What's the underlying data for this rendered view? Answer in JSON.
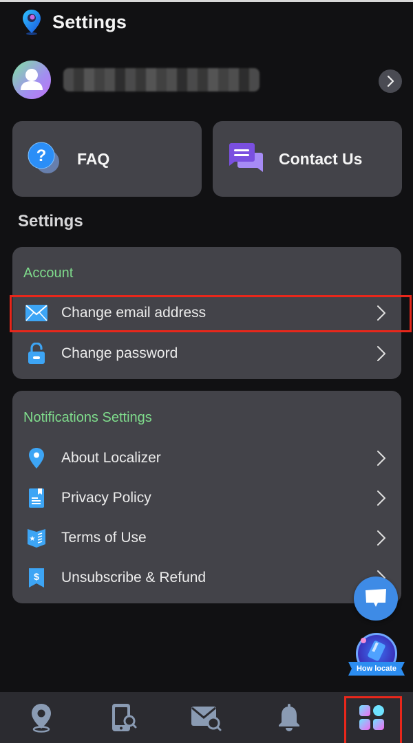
{
  "header": {
    "title": "Settings",
    "logo_icon": "map-pin-logo-icon"
  },
  "profile": {
    "avatar_icon": "user-icon",
    "username": "",
    "username_redacted": true,
    "chevron_icon": "chevron-right-icon"
  },
  "quick_actions": [
    {
      "label": "FAQ",
      "icon": "question-bubble-icon"
    },
    {
      "label": "Contact Us",
      "icon": "chat-bubbles-icon"
    }
  ],
  "section_title": "Settings",
  "groups": [
    {
      "title": "Account",
      "items": [
        {
          "label": "Change email address",
          "icon": "envelope-icon",
          "highlighted": true
        },
        {
          "label": "Change password",
          "icon": "unlock-icon",
          "highlighted": false
        }
      ]
    },
    {
      "title": "Notifications Settings",
      "items": [
        {
          "label": "About Localizer",
          "icon": "location-pin-icon"
        },
        {
          "label": "Privacy Policy",
          "icon": "document-icon"
        },
        {
          "label": "Terms of Use",
          "icon": "book-icon"
        },
        {
          "label": "Unsubscribe & Refund",
          "icon": "dollar-bookmark-icon"
        }
      ]
    }
  ],
  "floating": {
    "chat_icon": "chat-icon",
    "how_locate_label": "How locate"
  },
  "bottom_nav": {
    "items": [
      {
        "name": "locate",
        "icon": "map-pin-icon",
        "active": false
      },
      {
        "name": "phone-search",
        "icon": "phone-search-icon",
        "active": false
      },
      {
        "name": "mail-search",
        "icon": "mail-search-icon",
        "active": false
      },
      {
        "name": "notifications",
        "icon": "bell-icon",
        "active": false
      },
      {
        "name": "apps",
        "icon": "apps-grid-icon",
        "active": true
      }
    ]
  },
  "colors": {
    "background": "#111113",
    "card": "#434349",
    "group_title": "#7fdc8c",
    "icon_blue": "#3da5f5",
    "highlight": "#e8271b",
    "nav_bg": "#2b2b30",
    "nav_icon": "#8a9bb3"
  }
}
